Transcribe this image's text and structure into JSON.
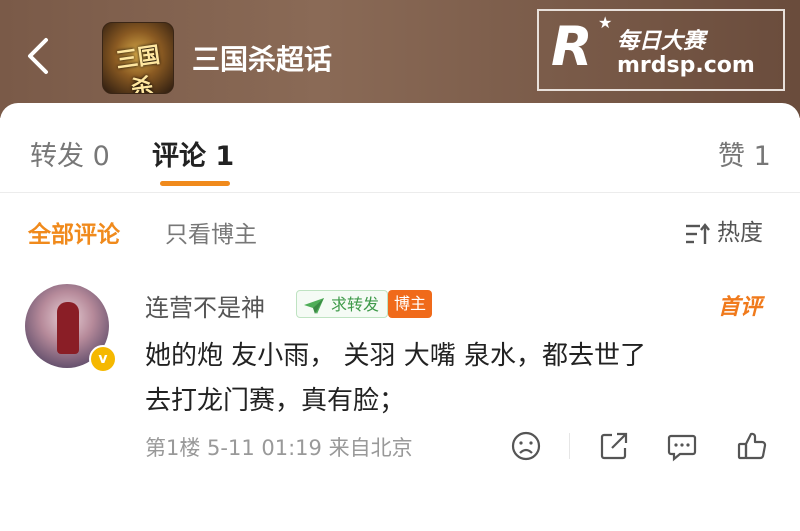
{
  "header": {
    "title": "三国杀超话",
    "group_emblem": "三国杀"
  },
  "watermark": {
    "brand_cn": "每日大赛",
    "url": "mrdsp.com",
    "letter": "R"
  },
  "tabs": {
    "repost": "转发 0",
    "comments": "评论 1",
    "likes": "赞 1"
  },
  "filters": {
    "all": "全部评论",
    "owner_only": "只看博主",
    "sort": "热度"
  },
  "comment": {
    "username": "连营不是神",
    "repost_badge": "求转发",
    "owner_badge": "博主",
    "first_comment_label": "首评",
    "text": "她的炮 友小雨， 关羽  大嘴  泉水，都去世了\n去打龙门赛，真有脸；",
    "meta": "第1楼  5-11 01:19  来自北京"
  },
  "icons": {
    "back": "chevron-left-icon",
    "sort": "sort-lines-icon",
    "verified": "verified-badge-icon",
    "repost_badge": "paper-plane-icon",
    "dislike": "frown-face-icon",
    "share": "share-icon",
    "reply": "comment-bubble-icon",
    "like": "thumbs-up-icon"
  },
  "colors": {
    "accent": "#f08a1c",
    "owner_badge": "#f06a1a",
    "repost_badge": "#3f9a4a",
    "verified": "#f5b800"
  }
}
